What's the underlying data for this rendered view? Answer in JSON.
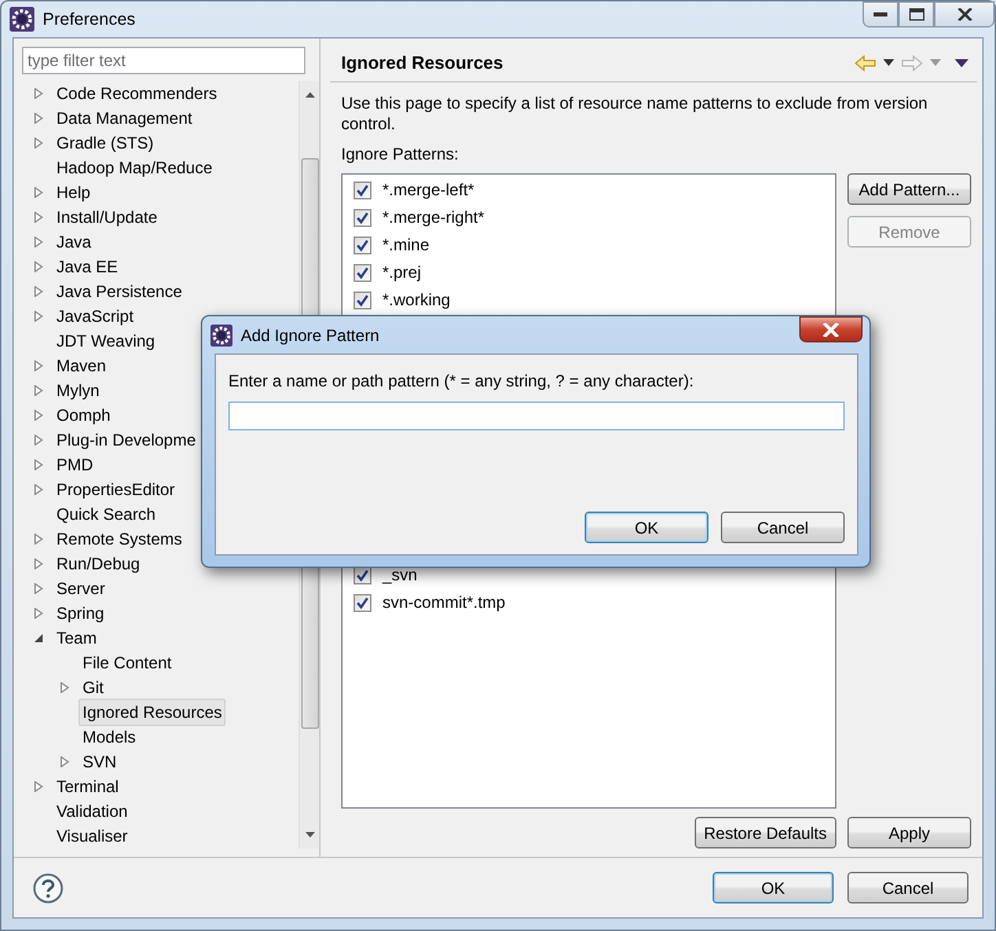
{
  "window": {
    "title": "Preferences"
  },
  "filter": {
    "placeholder": "type filter text"
  },
  "tree": [
    {
      "label": "Code Recommenders",
      "kind": "collapsed",
      "selected": false
    },
    {
      "label": "Data Management",
      "kind": "collapsed",
      "selected": false
    },
    {
      "label": "Gradle (STS)",
      "kind": "collapsed",
      "selected": false
    },
    {
      "label": "Hadoop Map/Reduce",
      "kind": "leaf",
      "selected": false
    },
    {
      "label": "Help",
      "kind": "collapsed",
      "selected": false
    },
    {
      "label": "Install/Update",
      "kind": "collapsed",
      "selected": false
    },
    {
      "label": "Java",
      "kind": "collapsed",
      "selected": false
    },
    {
      "label": "Java EE",
      "kind": "collapsed",
      "selected": false
    },
    {
      "label": "Java Persistence",
      "kind": "collapsed",
      "selected": false
    },
    {
      "label": "JavaScript",
      "kind": "collapsed",
      "selected": false
    },
    {
      "label": "JDT Weaving",
      "kind": "leaf",
      "selected": false
    },
    {
      "label": "Maven",
      "kind": "collapsed",
      "selected": false
    },
    {
      "label": "Mylyn",
      "kind": "collapsed",
      "selected": false
    },
    {
      "label": "Oomph",
      "kind": "collapsed",
      "selected": false
    },
    {
      "label": "Plug-in Developme",
      "kind": "collapsed",
      "selected": false
    },
    {
      "label": "PMD",
      "kind": "collapsed",
      "selected": false
    },
    {
      "label": "PropertiesEditor",
      "kind": "collapsed",
      "selected": false
    },
    {
      "label": "Quick Search",
      "kind": "leaf",
      "selected": false
    },
    {
      "label": "Remote Systems",
      "kind": "collapsed",
      "selected": false
    },
    {
      "label": "Run/Debug",
      "kind": "collapsed",
      "selected": false
    },
    {
      "label": "Server",
      "kind": "collapsed",
      "selected": false
    },
    {
      "label": "Spring",
      "kind": "collapsed",
      "selected": false
    },
    {
      "label": "Team",
      "kind": "expanded",
      "selected": false,
      "children": [
        {
          "label": "File Content",
          "kind": "leaf",
          "selected": false
        },
        {
          "label": "Git",
          "kind": "collapsed",
          "selected": false
        },
        {
          "label": "Ignored Resources",
          "kind": "leaf",
          "selected": true
        },
        {
          "label": "Models",
          "kind": "leaf",
          "selected": false
        },
        {
          "label": "SVN",
          "kind": "collapsed",
          "selected": false
        }
      ]
    },
    {
      "label": "Terminal",
      "kind": "collapsed",
      "selected": false
    },
    {
      "label": "Validation",
      "kind": "leaf",
      "selected": false
    },
    {
      "label": "Visualiser",
      "kind": "leaf",
      "selected": false
    }
  ],
  "page": {
    "title": "Ignored Resources",
    "description": "Use this page to specify a list of resource name patterns to exclude from version control.",
    "list_label": "Ignore Patterns:",
    "patterns": [
      {
        "label": "*.merge-left*",
        "checked": true
      },
      {
        "label": "*.merge-right*",
        "checked": true
      },
      {
        "label": "*.mine",
        "checked": true
      },
      {
        "label": "*.prej",
        "checked": true
      },
      {
        "label": "*.working",
        "checked": true
      }
    ],
    "patterns_below_dialog": [
      {
        "label": "_svn",
        "checked": true
      },
      {
        "label": "svn-commit*.tmp",
        "checked": true
      }
    ],
    "side_buttons": [
      {
        "label": "Add Pattern...",
        "disabled": false
      },
      {
        "label": "Remove",
        "disabled": true
      }
    ],
    "bottom_buttons": [
      {
        "label": "Restore Defaults"
      },
      {
        "label": "Apply"
      }
    ]
  },
  "footer_buttons": [
    {
      "label": "OK",
      "default": true
    },
    {
      "label": "Cancel",
      "default": false
    }
  ],
  "dialog": {
    "title": "Add Ignore Pattern",
    "prompt": "Enter a name or path pattern (* = any string, ? = any character):",
    "buttons": [
      {
        "label": "OK",
        "default": true
      },
      {
        "label": "Cancel",
        "default": false
      }
    ]
  }
}
